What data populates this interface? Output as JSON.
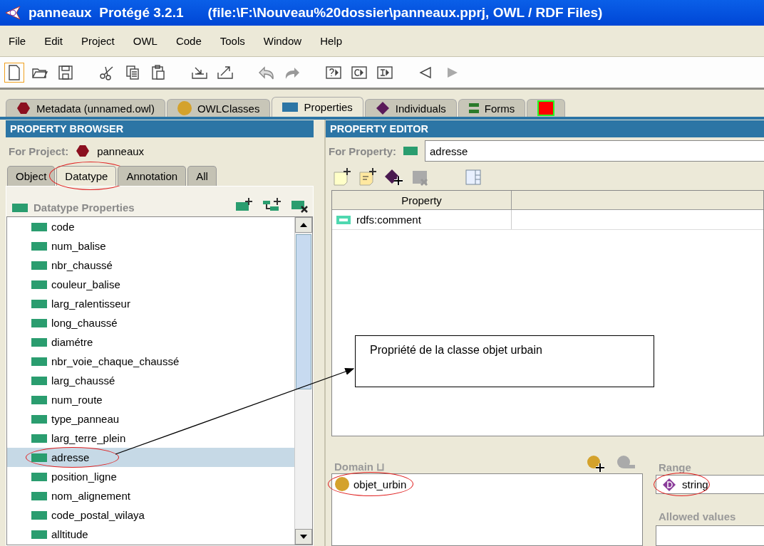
{
  "window": {
    "title": "panneaux  Protégé 3.2.1",
    "path": "(file:\\F:\\Nouveau%20dossier\\panneaux.pprj, OWL / RDF Files)"
  },
  "menu": [
    "File",
    "Edit",
    "Project",
    "OWL",
    "Code",
    "Tools",
    "Window",
    "Help"
  ],
  "toolbar": [
    {
      "kind": "new",
      "focused": true,
      "disabled": false
    },
    {
      "kind": "open",
      "focused": false,
      "disabled": false
    },
    {
      "kind": "save",
      "focused": false,
      "disabled": false
    },
    {
      "kind": "gap"
    },
    {
      "kind": "cut",
      "focused": false,
      "disabled": false
    },
    {
      "kind": "copy",
      "focused": false,
      "disabled": false
    },
    {
      "kind": "paste",
      "focused": false,
      "disabled": false
    },
    {
      "kind": "gap"
    },
    {
      "kind": "import",
      "focused": false,
      "disabled": false
    },
    {
      "kind": "export",
      "focused": false,
      "disabled": false
    },
    {
      "kind": "gap"
    },
    {
      "kind": "undo",
      "focused": false,
      "disabled": false
    },
    {
      "kind": "redo",
      "focused": false,
      "disabled": true
    },
    {
      "kind": "gap"
    },
    {
      "kind": "query",
      "focused": false,
      "disabled": false
    },
    {
      "kind": "class",
      "focused": false,
      "disabled": false
    },
    {
      "kind": "instance",
      "focused": false,
      "disabled": false
    },
    {
      "kind": "gap"
    },
    {
      "kind": "back",
      "focused": false,
      "disabled": false
    },
    {
      "kind": "forward",
      "focused": false,
      "disabled": true
    }
  ],
  "tabs": [
    {
      "label": "Metadata (unnamed.owl)",
      "kind": "hexagon",
      "selected": false
    },
    {
      "label": "OWLClasses",
      "kind": "circle",
      "selected": false
    },
    {
      "label": "Properties",
      "kind": "square",
      "selected": true
    },
    {
      "label": "Individuals",
      "kind": "diamond",
      "selected": false
    },
    {
      "label": "Forms",
      "kind": "bars",
      "selected": false
    },
    {
      "kind": "flag",
      "selected": false
    }
  ],
  "browser": {
    "header": "PROPERTY BROWSER",
    "project_label": "For Project:",
    "project": "panneaux",
    "subtabs": [
      {
        "label": "Object",
        "selected": false,
        "circled": false
      },
      {
        "label": "Datatype",
        "selected": true,
        "circled": true
      },
      {
        "label": "Annotation",
        "selected": false,
        "circled": false
      },
      {
        "label": "All",
        "selected": false,
        "circled": false
      }
    ],
    "list_title": "Datatype Properties",
    "items": [
      {
        "label": "code",
        "selected": false,
        "circled": false
      },
      {
        "label": "num_balise",
        "selected": false,
        "circled": false
      },
      {
        "label": "nbr_chaussé",
        "selected": false,
        "circled": false
      },
      {
        "label": "couleur_balise",
        "selected": false,
        "circled": false
      },
      {
        "label": "larg_ralentisseur",
        "selected": false,
        "circled": false
      },
      {
        "label": "long_chaussé",
        "selected": false,
        "circled": false
      },
      {
        "label": "diamétre",
        "selected": false,
        "circled": false
      },
      {
        "label": "nbr_voie_chaque_chaussé",
        "selected": false,
        "circled": false
      },
      {
        "label": "larg_chaussé",
        "selected": false,
        "circled": false
      },
      {
        "label": "num_route",
        "selected": false,
        "circled": false
      },
      {
        "label": "type_panneau",
        "selected": false,
        "circled": false
      },
      {
        "label": "larg_terre_plein",
        "selected": false,
        "circled": false
      },
      {
        "label": "adresse",
        "selected": true,
        "circled": true
      },
      {
        "label": "position_ligne",
        "selected": false,
        "circled": false
      },
      {
        "label": "nom_alignement",
        "selected": false,
        "circled": false
      },
      {
        "label": "code_postal_wilaya",
        "selected": false,
        "circled": false
      },
      {
        "label": "alltitude",
        "selected": false,
        "circled": false
      }
    ]
  },
  "editor": {
    "header": "PROPERTY EDITOR",
    "property_label": "For Property:",
    "property": "adresse",
    "table": {
      "columns": [
        "Property"
      ],
      "rows": [
        {
          "property": "rdfs:comment"
        }
      ]
    },
    "domain": {
      "label": "Domain",
      "symbol": "⊔",
      "items": [
        {
          "label": "objet_urbin",
          "circled": true
        }
      ]
    },
    "range": {
      "label": "Range",
      "value": "string",
      "circled": true
    },
    "allowed_values": {
      "label": "Allowed values"
    }
  },
  "callout": {
    "text": "Propriété de la classe objet urbain"
  }
}
